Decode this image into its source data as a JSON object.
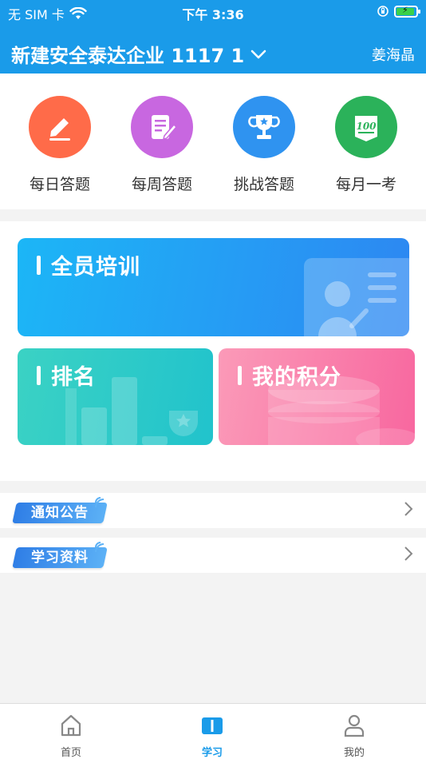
{
  "status_bar": {
    "carrier": "无 SIM 卡",
    "time": "下午 3:36"
  },
  "header": {
    "org_name": "新建安全泰达企业 1117 1",
    "user_name": "姜海晶"
  },
  "quick_actions": [
    {
      "label": "每日答题",
      "icon": "pen-icon",
      "color": "#ff6b49"
    },
    {
      "label": "每周答题",
      "icon": "notebook-pen-icon",
      "color": "#c867e0"
    },
    {
      "label": "挑战答题",
      "icon": "trophy-icon",
      "color": "#2f93f0"
    },
    {
      "label": "每月一考",
      "icon": "exam-100-icon",
      "color": "#2bb25a"
    }
  ],
  "cards": {
    "training": "全员培训",
    "ranking": "排名",
    "points": "我的积分"
  },
  "list_rows": [
    {
      "label": "通知公告"
    },
    {
      "label": "学习资料"
    }
  ],
  "tabbar": [
    {
      "label": "首页",
      "icon": "home-icon"
    },
    {
      "label": "学习",
      "icon": "book-icon",
      "active": true
    },
    {
      "label": "我的",
      "icon": "person-icon"
    }
  ]
}
